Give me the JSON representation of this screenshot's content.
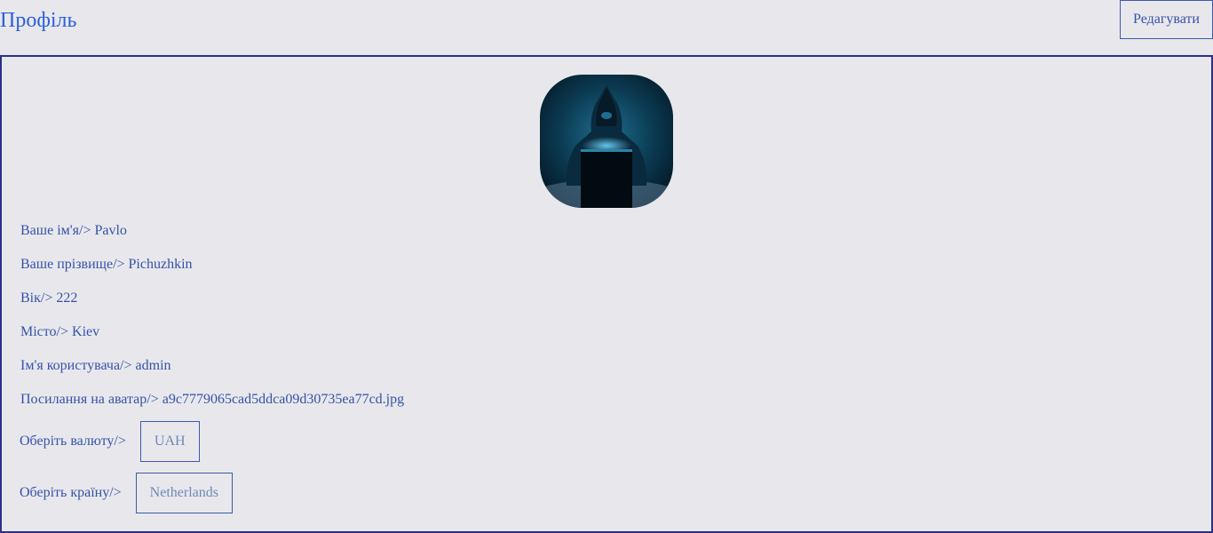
{
  "header": {
    "title": "Профіль",
    "edit_label": "Редагувати"
  },
  "profile": {
    "avatar_icon": "avatar-image",
    "fields": [
      {
        "label": "Ваше ім'я/>",
        "value": "Pavlo"
      },
      {
        "label": "Ваше прізвище/>",
        "value": "Pichuzhkin"
      },
      {
        "label": "Вік/>",
        "value": "222"
      },
      {
        "label": "Місто/>",
        "value": "Kiev"
      },
      {
        "label": "Ім'я користувача/>",
        "value": "admin"
      },
      {
        "label": "Посилання на аватар/>",
        "value": "a9c7779065cad5ddca09d30735ea77cd.jpg"
      }
    ],
    "currency": {
      "label": "Оберіть валюту/>",
      "value": "UAH"
    },
    "country": {
      "label": "Оберіть країну/>",
      "value": "Netherlands"
    }
  },
  "colors": {
    "accent": "#2b5fd9",
    "text": "#3552a8",
    "border": "#2c2f8a",
    "background": "#e8e8ec"
  }
}
